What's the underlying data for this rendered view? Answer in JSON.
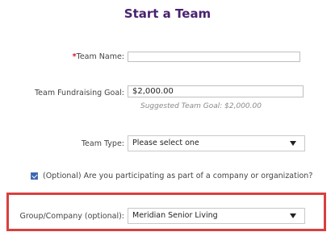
{
  "page": {
    "title": "Start a Team"
  },
  "form": {
    "team_name": {
      "required_marker": "*",
      "label": "Team Name:",
      "value": ""
    },
    "fundraising_goal": {
      "label": "Team Fundraising Goal:",
      "value": "$2,000.00",
      "hint": "Suggested Team Goal: $2,000.00"
    },
    "team_type": {
      "label": "Team Type:",
      "selected": "Please select one"
    },
    "company_checkbox": {
      "checked": true,
      "label": "(Optional) Are you participating as part of a company or organization?"
    },
    "group_company": {
      "label": "Group/Company (optional):",
      "selected": "Meridian Senior Living"
    }
  },
  "colors": {
    "title": "#4a2270",
    "required": "#d0142c",
    "highlight_border": "#d8403f",
    "checkbox": "#3a66b7"
  }
}
